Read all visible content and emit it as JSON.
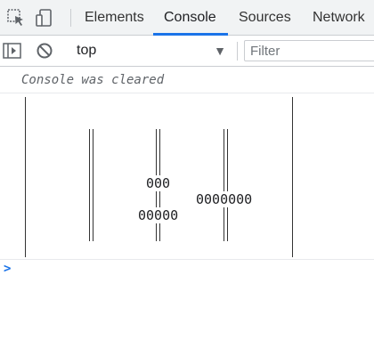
{
  "tabbar": {
    "inspect_icon": "element-picker-icon",
    "device_icon": "device-toggle-icon",
    "tabs": [
      "Elements",
      "Console",
      "Sources",
      "Network"
    ],
    "active_tab": "Console"
  },
  "toolbar": {
    "sidebar_icon": "sidebar-toggle-icon",
    "clear_icon": "clear-console-icon",
    "context": "top",
    "filter_placeholder": "Filter"
  },
  "console": {
    "cleared_message": "Console was cleared",
    "values": [
      "000",
      "0000000",
      "00000"
    ],
    "prompt_symbol": ">"
  },
  "colors": {
    "accent": "#1a73e8",
    "tabbar_bg": "#f1f3f4",
    "text": "#202124"
  }
}
